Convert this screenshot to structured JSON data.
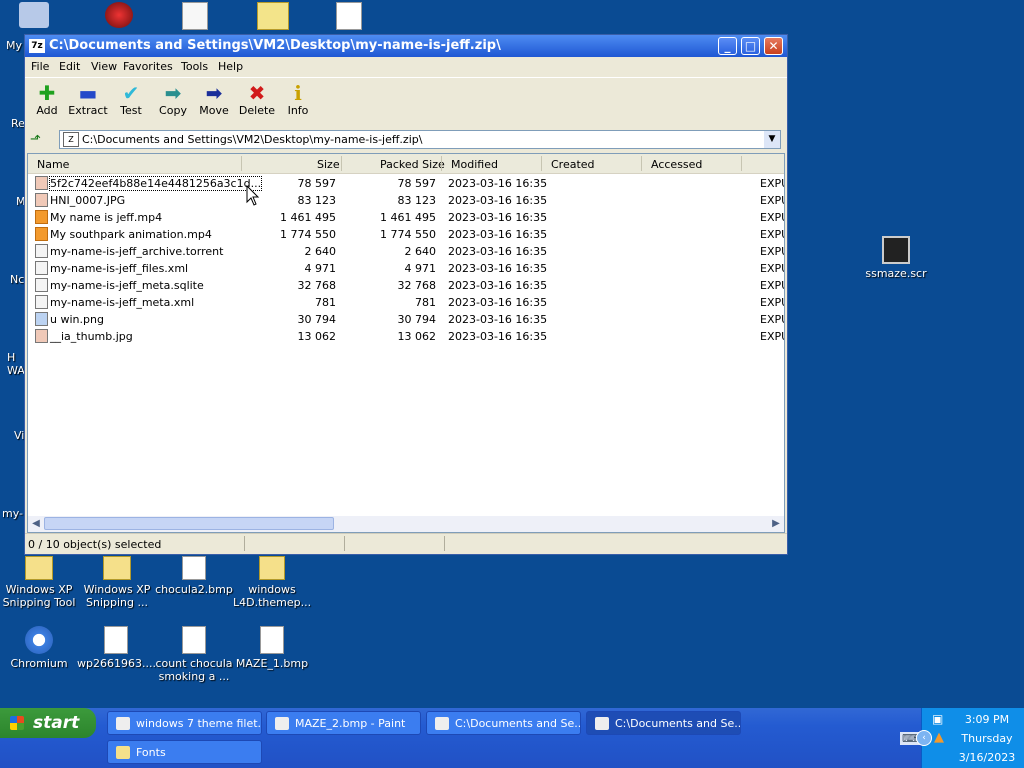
{
  "desktop": {
    "icons_bottom": [
      {
        "label": "Windows XP Snipping Tool"
      },
      {
        "label": "Windows XP Snipping ..."
      },
      {
        "label": "chocula2.bmp"
      },
      {
        "label": "windows L4D.themep..."
      },
      {
        "label": "Chromium"
      },
      {
        "label": "wp2661963...."
      },
      {
        "label": "count chocula smoking a ..."
      },
      {
        "label": "MAZE_1.bmp"
      }
    ],
    "icon_right": {
      "label": "ssmaze.scr"
    },
    "left_fragments": [
      "My",
      "Re",
      "M",
      "Nc",
      "H WA",
      "Vi",
      "my-r"
    ]
  },
  "window": {
    "title": "C:\\Documents and Settings\\VM2\\Desktop\\my-name-is-jeff.zip\\",
    "app_icon_text": "7z",
    "menu": [
      "File",
      "Edit",
      "View",
      "Favorites",
      "Tools",
      "Help"
    ],
    "toolbar": [
      {
        "label": "Add",
        "icon": "add-icon"
      },
      {
        "label": "Extract",
        "icon": "extract-icon"
      },
      {
        "label": "Test",
        "icon": "test-icon"
      },
      {
        "label": "Copy",
        "icon": "copy-icon"
      },
      {
        "label": "Move",
        "icon": "move-icon"
      },
      {
        "label": "Delete",
        "icon": "delete-icon"
      },
      {
        "label": "Info",
        "icon": "info-icon"
      }
    ],
    "address": "C:\\Documents and Settings\\VM2\\Desktop\\my-name-is-jeff.zip\\",
    "columns": [
      "Name",
      "Size",
      "Packed Size",
      "Modified",
      "Created",
      "Accessed"
    ],
    "files": [
      {
        "name": "5f2c742eef4b88e14e4481256a3c1d...",
        "size": "78 597",
        "packed": "78 597",
        "modified": "2023-03-16 16:35",
        "extra": "EXPU"
      },
      {
        "name": "HNI_0007.JPG",
        "size": "83 123",
        "packed": "83 123",
        "modified": "2023-03-16 16:35",
        "extra": "EXPU"
      },
      {
        "name": "My name is jeff.mp4",
        "size": "1 461 495",
        "packed": "1 461 495",
        "modified": "2023-03-16 16:35",
        "extra": "EXPU"
      },
      {
        "name": "My southpark animation.mp4",
        "size": "1 774 550",
        "packed": "1 774 550",
        "modified": "2023-03-16 16:35",
        "extra": "EXPU"
      },
      {
        "name": "my-name-is-jeff_archive.torrent",
        "size": "2 640",
        "packed": "2 640",
        "modified": "2023-03-16 16:35",
        "extra": "EXPU"
      },
      {
        "name": "my-name-is-jeff_files.xml",
        "size": "4 971",
        "packed": "4 971",
        "modified": "2023-03-16 16:35",
        "extra": "EXPU"
      },
      {
        "name": "my-name-is-jeff_meta.sqlite",
        "size": "32 768",
        "packed": "32 768",
        "modified": "2023-03-16 16:35",
        "extra": "EXPU"
      },
      {
        "name": "my-name-is-jeff_meta.xml",
        "size": "781",
        "packed": "781",
        "modified": "2023-03-16 16:35",
        "extra": "EXPU"
      },
      {
        "name": "u win.png",
        "size": "30 794",
        "packed": "30 794",
        "modified": "2023-03-16 16:35",
        "extra": "EXPU"
      },
      {
        "name": "__ia_thumb.jpg",
        "size": "13 062",
        "packed": "13 062",
        "modified": "2023-03-16 16:35",
        "extra": "EXPU"
      }
    ],
    "status": "0 / 10 object(s) selected"
  },
  "taskbar": {
    "start_label": "start",
    "tasks": [
      {
        "label": "windows 7 theme filet..."
      },
      {
        "label": "MAZE_2.bmp - Paint"
      },
      {
        "label": "C:\\Documents and Se..."
      },
      {
        "label": "C:\\Documents and Se..."
      },
      {
        "label": "Fonts"
      }
    ],
    "clock": {
      "time": "3:09 PM",
      "day": "Thursday",
      "date": "3/16/2023"
    }
  }
}
